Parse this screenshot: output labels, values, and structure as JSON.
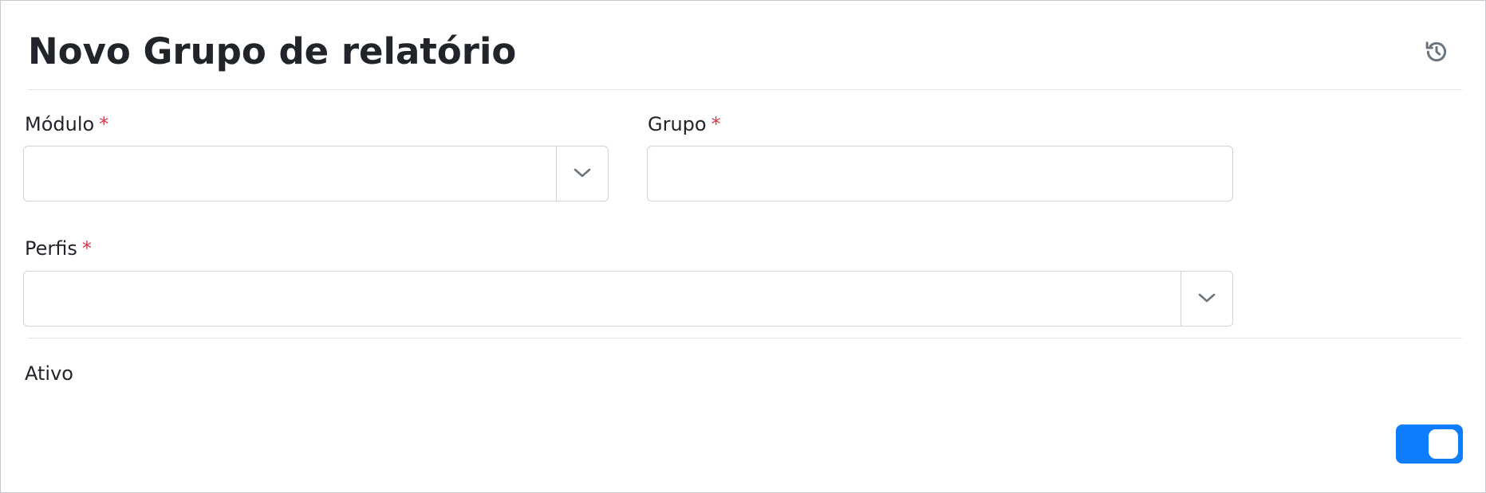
{
  "header": {
    "title": "Novo Grupo de relatório",
    "history_icon": "history-icon"
  },
  "form": {
    "modulo": {
      "label": "Módulo",
      "required_mark": "*",
      "selected_value": "",
      "dropdown_icon": "chevron-down-icon"
    },
    "grupo": {
      "label": "Grupo",
      "required_mark": "*",
      "value": "",
      "placeholder": ""
    },
    "perfis": {
      "label": "Perfis",
      "required_mark": "*",
      "selected_value": "",
      "dropdown_icon": "chevron-down-icon"
    },
    "ativo": {
      "label": "Ativo",
      "checked": true
    }
  },
  "colors": {
    "accent": "#0d7dfd",
    "required": "#dc3545",
    "border": "#ced4da",
    "text": "#212529",
    "icon": "#6c757d"
  }
}
